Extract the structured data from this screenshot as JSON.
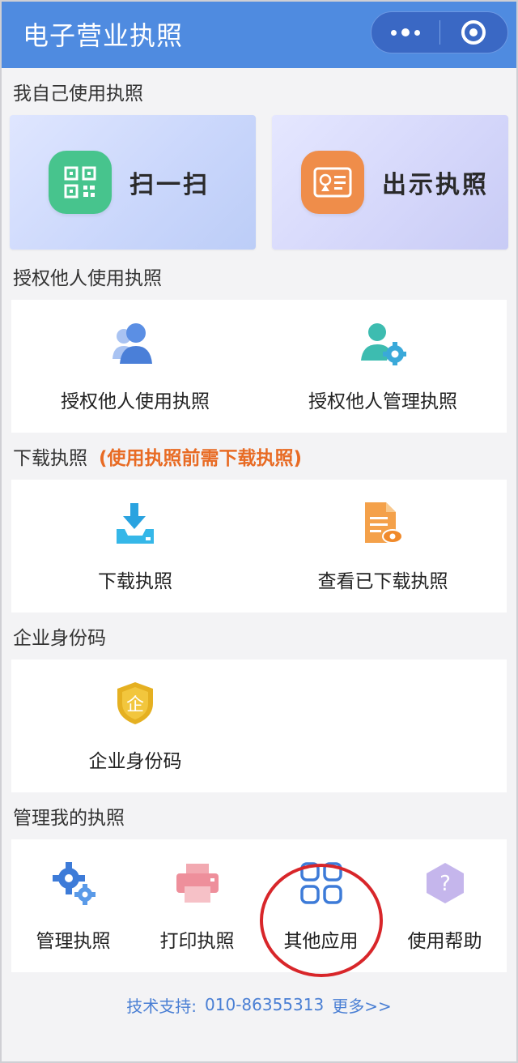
{
  "header": {
    "title": "电子营业执照"
  },
  "self_use": {
    "title": "我自己使用执照",
    "tiles": [
      {
        "label": "扫一扫",
        "icon": "qr-code-icon"
      },
      {
        "label": "出示执照",
        "icon": "license-card-icon"
      }
    ]
  },
  "authorize": {
    "title": "授权他人使用执照",
    "items": [
      {
        "label": "授权他人使用执照",
        "icon": "users-icon"
      },
      {
        "label": "授权他人管理执照",
        "icon": "user-gear-icon"
      }
    ]
  },
  "download": {
    "title": "下载执照",
    "note": "(使用执照前需下载执照)",
    "items": [
      {
        "label": "下载执照",
        "icon": "download-icon"
      },
      {
        "label": "查看已下载执照",
        "icon": "view-document-icon"
      }
    ]
  },
  "enterprise": {
    "title": "企业身份码",
    "items": [
      {
        "label": "企业身份码",
        "icon": "shield-badge-icon",
        "badge_char": "企"
      }
    ]
  },
  "manage": {
    "title": "管理我的执照",
    "items": [
      {
        "label": "管理执照",
        "icon": "gears-icon"
      },
      {
        "label": "打印执照",
        "icon": "printer-icon"
      },
      {
        "label": "其他应用",
        "icon": "apps-grid-icon"
      },
      {
        "label": "使用帮助",
        "icon": "help-icon"
      }
    ]
  },
  "footer": {
    "support_label": "技术支持:",
    "phone": "010-86355313",
    "more_label": "更多>>"
  },
  "colors": {
    "header_bg": "#4f8be0",
    "accent_note": "#e86b24",
    "link": "#4a7fd4",
    "annotation": "#d8262a"
  }
}
